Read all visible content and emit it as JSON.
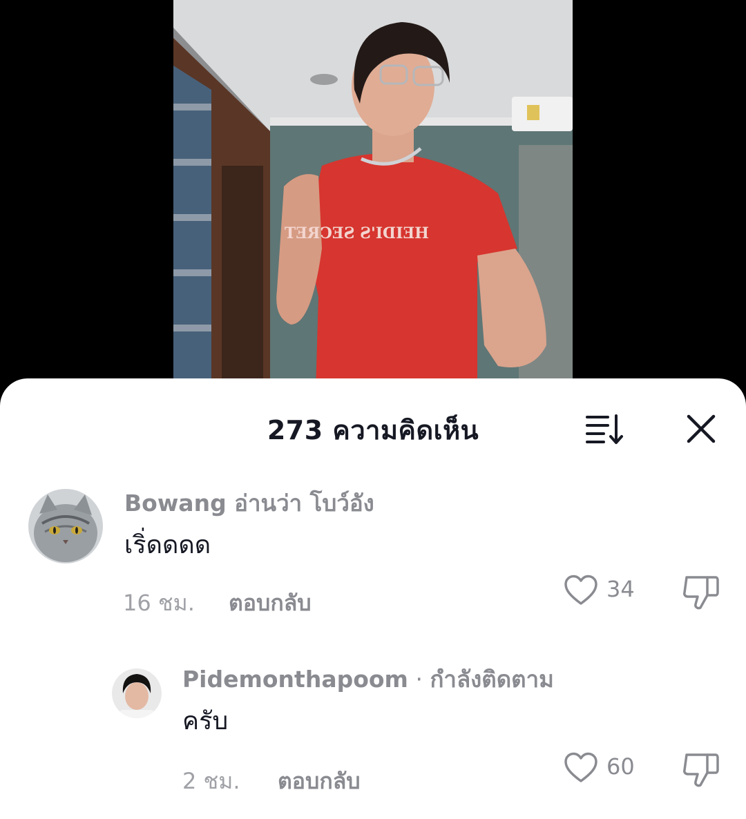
{
  "header": {
    "comment_count_title": "273 ความคิดเห็น"
  },
  "comments": [
    {
      "username": "Bowang อ่านว่า โบว์อัง",
      "text": "เริ่ดดดด",
      "time": "16 ชม.",
      "reply_label": "ตอบกลับ",
      "likes": "34"
    },
    {
      "username": "Pidemonthapoom",
      "separator": " · ",
      "badge": "กำลังติดตาม",
      "text": "ครับ",
      "time": "2 ชม.",
      "reply_label": "ตอบกลับ",
      "likes": "60"
    }
  ],
  "icons": {
    "sort": "sort-descending-icon",
    "close": "close-icon",
    "like": "heart-outline-icon",
    "dislike": "thumbs-down-icon"
  },
  "colors": {
    "text_primary": "#161823",
    "text_secondary": "#8a8b91",
    "sheet_bg": "#ffffff"
  }
}
